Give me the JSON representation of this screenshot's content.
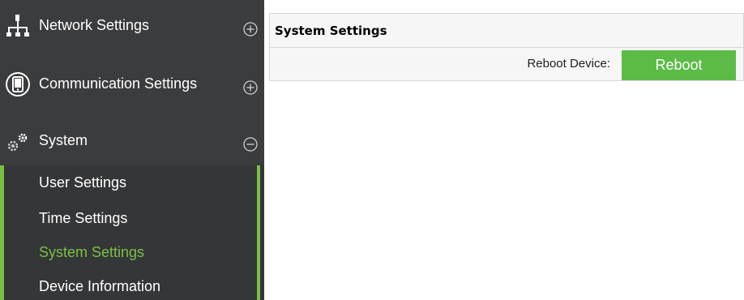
{
  "sidebar": {
    "items": [
      {
        "label": "Network Settings",
        "icon": "network-icon",
        "toggle": "expand-plus-icon"
      },
      {
        "label": "Communication Settings",
        "icon": "communication-icon",
        "toggle": "expand-plus-icon"
      },
      {
        "label": "System",
        "icon": "gears-icon",
        "toggle": "collapse-minus-icon"
      }
    ],
    "submenu": [
      {
        "label": "User Settings"
      },
      {
        "label": "Time Settings"
      },
      {
        "label": "System Settings",
        "active": true
      },
      {
        "label": "Device Information"
      }
    ]
  },
  "panel": {
    "title": "System Settings",
    "reboot_label": "Reboot Device:",
    "reboot_button": "Reboot"
  },
  "colors": {
    "sidebar_bg": "#3b3c3e",
    "accent_green": "#7ac143",
    "button_green": "#5cbb46"
  }
}
